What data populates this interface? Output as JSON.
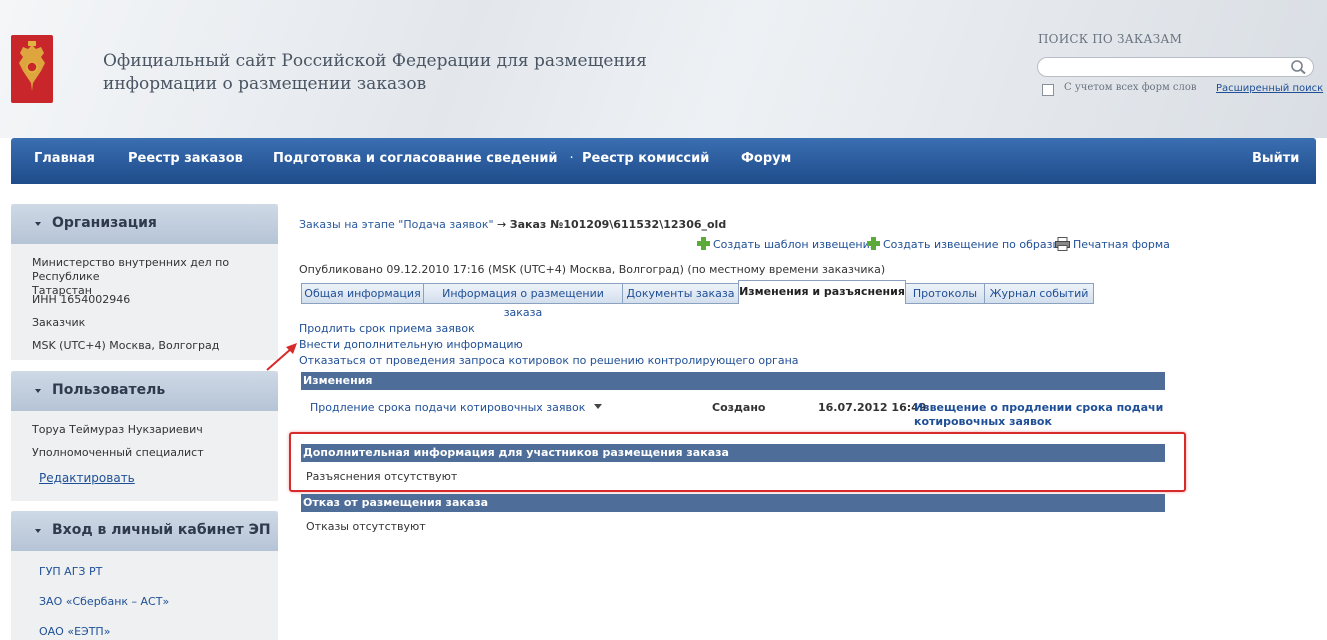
{
  "header": {
    "title_line1": "Официальный сайт Российской Федерации для размещения",
    "title_line2": "информации о размещении заказов",
    "search_caption": "ПОИСК ПО ЗАКАЗАМ",
    "search_value": "",
    "checkbox_label": "С учетом всех форм слов",
    "advanced_search": "Расширенный поиск"
  },
  "nav": {
    "items": [
      "Главная",
      "Реестр заказов",
      "Подготовка и согласование сведений",
      "Реестр комиссий",
      "Форум"
    ],
    "logout": "Выйти"
  },
  "sidebar": {
    "organization": {
      "title": "Организация",
      "name_line1": "Министерство внутренних дел по Республике",
      "name_line2": "Татарстан",
      "inn": "ИНН 1654002946",
      "role": "Заказчик",
      "timezone": "MSK (UTC+4) Москва, Волгоград"
    },
    "user": {
      "title": "Пользователь",
      "name": "Торуа Теймураз Нукзариевич",
      "position": "Уполномоченный специалист",
      "edit": "Редактировать"
    },
    "ep": {
      "title": "Вход в личный кабинет ЭП",
      "links": [
        "ГУП АГЗ РТ",
        "ЗАО «Сбербанк – АСТ»",
        "ОАО «ЕЭТП»"
      ]
    }
  },
  "main": {
    "breadcrumb_link": "Заказы на этапе \"Подача заявок\"",
    "breadcrumb_arrow": "→",
    "breadcrumb_current": "Заказ №101209\\611532\\12306_old",
    "actions": {
      "create_template": "Создать шаблон извещения",
      "create_by_sample": "Создать извещение по образцу",
      "print": "Печатная форма"
    },
    "published": "Опубликовано 09.12.2010 17:16 (MSK (UTC+4) Москва, Волгоград) (по местному времени заказчика)",
    "tabs": [
      "Общая информация",
      "Информация о размещении заказа",
      "Документы заказа",
      "Изменения и разъяснения",
      "Протоколы",
      "Журнал событий"
    ],
    "active_tab": "Изменения и разъяснения",
    "links": {
      "extend": "Продлить срок приема заявок",
      "add_info": "Внести дополнительную информацию",
      "refuse": "Отказаться от проведения запроса котировок по решению контролирующего органа"
    },
    "changes": {
      "title": "Изменения",
      "row": {
        "name": "Продление срока подачи котировочных заявок",
        "status": "Создано",
        "datetime": "16.07.2012 16:49",
        "doc_line1": "Извещение о продлении срока подачи",
        "doc_line2": "котировочных заявок"
      }
    },
    "additional": {
      "title": "Дополнительная информация для участников размещения заказа",
      "text": "Разъяснения отсутствуют"
    },
    "refusal": {
      "title": "Отказ от размещения заказа",
      "text": "Отказы отсутствуют"
    }
  },
  "colors": {
    "nav": "#2b5b9c",
    "section_header": "#4e6d98",
    "link": "#1f4f96",
    "highlight": "#d72a2a"
  }
}
